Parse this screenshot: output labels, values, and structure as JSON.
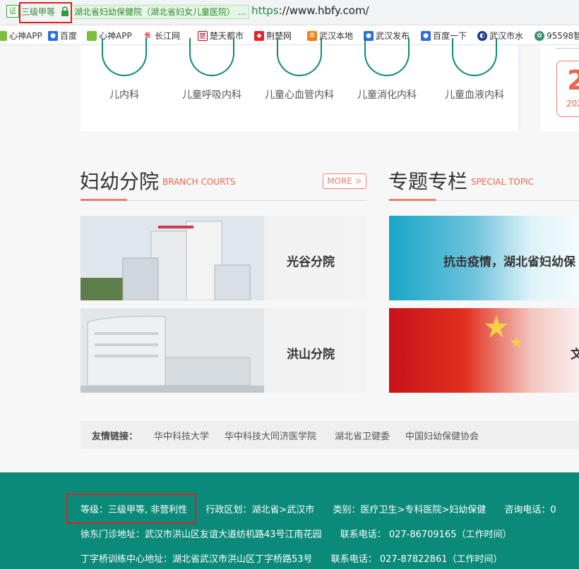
{
  "browser": {
    "cert_label": "证",
    "grade_label": "三级甲等",
    "site_name": "湖北省妇幼保健院（湖北省妇女儿童医院）",
    "site_more": "...",
    "url_scheme": "https",
    "url_rest": "://www.hbfy.com/"
  },
  "bookmarks": [
    {
      "label": "心神APP",
      "icon": "leaf-icon"
    },
    {
      "label": "百度",
      "icon": "baidu-paw-icon"
    },
    {
      "label": "心神APP",
      "icon": "leaf-icon"
    },
    {
      "label": "长江网",
      "icon": "cjn-icon"
    },
    {
      "label": "楚天都市",
      "icon": "chutian-icon"
    },
    {
      "label": "荆楚网",
      "icon": "jingchu-icon"
    },
    {
      "label": "武汉本地",
      "icon": "wuhan-local-icon"
    },
    {
      "label": "武汉发布",
      "icon": "baidu-paw-icon"
    },
    {
      "label": "百度一下",
      "icon": "baidu-paw-icon"
    },
    {
      "label": "武汉市水",
      "icon": "globe-icon"
    },
    {
      "label": "95598智",
      "icon": "grid-icon"
    }
  ],
  "departments": [
    "儿内科",
    "儿童呼吸内科",
    "儿童心血管内科",
    "儿童消化内科",
    "儿童血液内科"
  ],
  "date_card": {
    "day": "2",
    "year": "202"
  },
  "branch_section": {
    "title": "妇幼分院",
    "subtitle": "BRANCH COURTS",
    "more": "MORE >"
  },
  "branches": [
    "光谷分院",
    "洪山分院"
  ],
  "topic_section": {
    "title": "专题专栏",
    "subtitle": "SPECIAL TOPIC"
  },
  "topics": [
    "抗击疫情，湖北省妇幼保",
    "文"
  ],
  "links": {
    "label": "友情链接：",
    "items": [
      "华中科技大学",
      "华中科技大同济医学院",
      "湖北省卫健委",
      "中国妇幼保健协会"
    ]
  },
  "footer": {
    "row1": [
      "等级：三级甲等, 非营利性",
      "行政区划：湖北省>武汉市",
      "类别：医疗卫生>专科医院>妇幼保健",
      "咨询电话：0"
    ],
    "row2": [
      "徐东门诊地址：武汉市洪山区友谊大道纺机路43号江南花园",
      "联系电话：  027-86709165（工作时间）"
    ],
    "row3": [
      "丁字桥训练中心地址：湖北省武汉市洪山区丁字桥路53号",
      "联系电话：  027-87822861（工作时间）"
    ]
  },
  "colors": {
    "teal": "#0b8a7a",
    "accent": "#e8806f",
    "highlight_box": "#e02020"
  }
}
